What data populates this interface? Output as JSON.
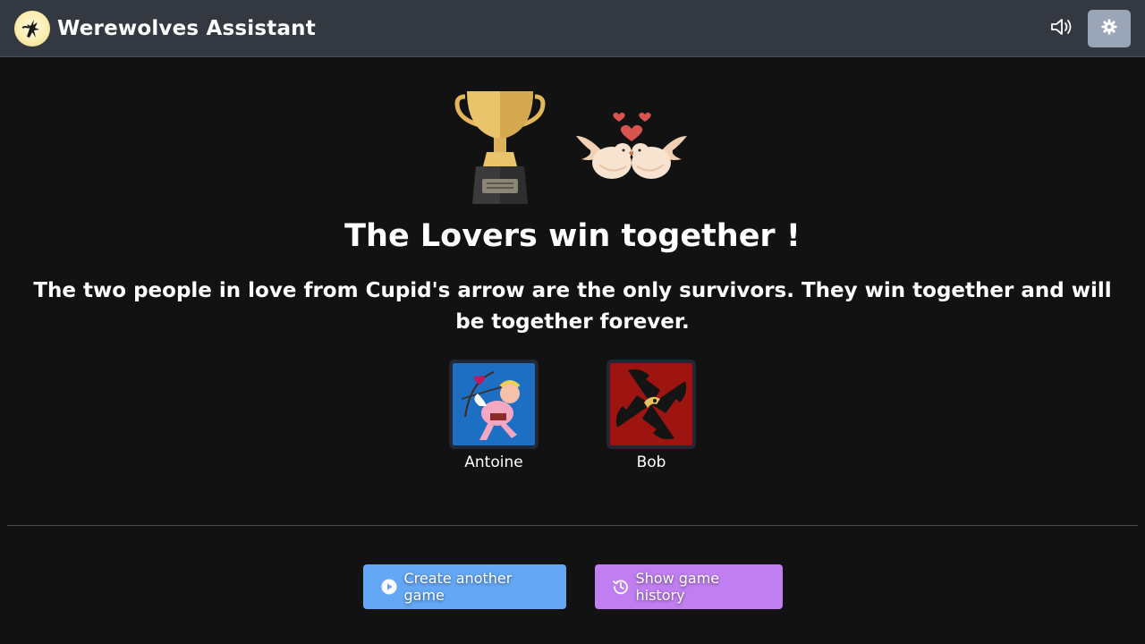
{
  "app": {
    "title": "Werewolves Assistant",
    "logo_icon": "werewolf-howl-logo"
  },
  "header": {
    "sound_icon": "volume-icon",
    "settings_icon": "gear-icon"
  },
  "victory": {
    "trophy_icon": "trophy-icon",
    "lovers_icon": "love-doves-icon",
    "title": "The Lovers win together !",
    "description": "The two people in love from Cupid's arrow are the only survivors. They win together and will be together forever."
  },
  "winners": [
    {
      "name": "Antoine",
      "role_icon": "cupid-role-icon"
    },
    {
      "name": "Bob",
      "role_icon": "werewolf-role-icon"
    }
  ],
  "actions": {
    "create_label": "Create another game",
    "create_icon": "play-circle-icon",
    "history_label": "Show game history",
    "history_icon": "history-icon"
  },
  "colors": {
    "background": "#121212",
    "navbar": "#343841",
    "settings_button": "#9aa5b8",
    "create_button": "#64a7f5",
    "history_button": "#c07ef0"
  }
}
